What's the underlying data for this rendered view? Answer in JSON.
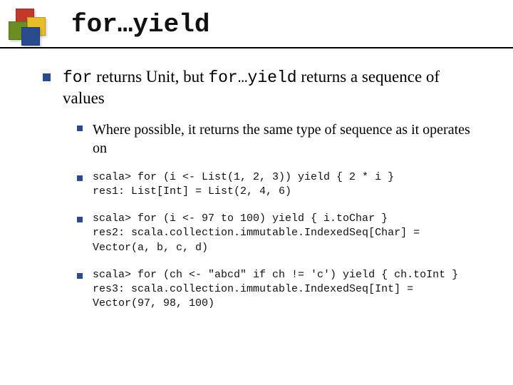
{
  "title": "for…yield",
  "main": {
    "seg1": "for",
    "seg2": " returns Unit, but ",
    "seg3": "for…yield",
    "seg4": " returns a sequence of values"
  },
  "sub": [
    "Where possible, it returns the same type of sequence as it operates on",
    "scala> for (i <- List(1, 2, 3)) yield { 2 * i }\nres1: List[Int] = List(2, 4, 6)",
    "scala> for (i <- 97 to 100) yield { i.toChar }\nres2: scala.collection.immutable.IndexedSeq[Char] = Vector(a, b, c, d)",
    "scala> for (ch <- \"abcd\" if ch != 'c') yield { ch.toInt }\nres3: scala.collection.immutable.IndexedSeq[Int] = Vector(97, 98, 100)"
  ]
}
